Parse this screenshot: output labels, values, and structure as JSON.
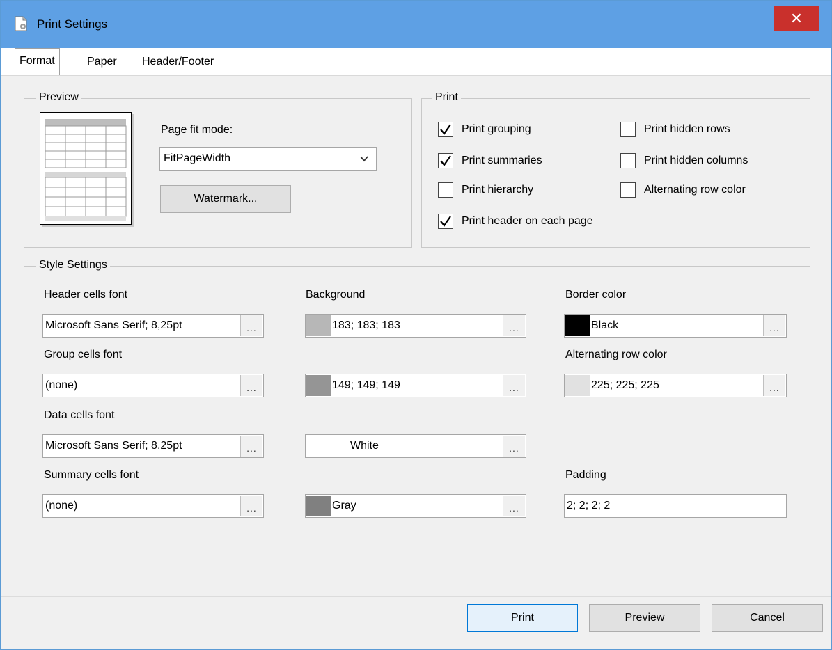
{
  "window": {
    "title": "Print Settings",
    "close_symbol": "✕"
  },
  "tabs": [
    {
      "label": "Format",
      "active": true
    },
    {
      "label": "Paper",
      "active": false
    },
    {
      "label": "Header/Footer",
      "active": false
    }
  ],
  "preview": {
    "group_title": "Preview",
    "page_fit_label": "Page fit mode:",
    "page_fit_value": "FitPageWidth",
    "watermark_button": "Watermark..."
  },
  "print": {
    "group_title": "Print",
    "options": [
      {
        "label": "Print grouping",
        "checked": true
      },
      {
        "label": "Print summaries",
        "checked": true
      },
      {
        "label": "Print hierarchy",
        "checked": false
      },
      {
        "label": "Print header on each page",
        "checked": true
      },
      {
        "label": "Print hidden rows",
        "checked": false
      },
      {
        "label": "Print hidden columns",
        "checked": false
      },
      {
        "label": "Alternating row color",
        "checked": false
      }
    ]
  },
  "style": {
    "group_title": "Style Settings",
    "fonts": [
      {
        "label": "Header cells font",
        "value": "Microsoft Sans Serif; 8,25pt"
      },
      {
        "label": "Group cells font",
        "value": "(none)"
      },
      {
        "label": "Data cells font",
        "value": "Microsoft Sans Serif; 8,25pt"
      },
      {
        "label": "Summary cells font",
        "value": "(none)"
      }
    ],
    "background_label": "Background",
    "backgrounds": [
      {
        "value": "183; 183; 183",
        "color": "#b7b7b7"
      },
      {
        "value": "149; 149; 149",
        "color": "#959595"
      },
      {
        "value": "White",
        "color": "#ffffff"
      },
      {
        "value": "Gray",
        "color": "#808080"
      }
    ],
    "border_color_label": "Border color",
    "border_color": {
      "value": "Black",
      "color": "#000000"
    },
    "alternating_label": "Alternating row color",
    "alternating": {
      "value": "225; 225; 225",
      "color": "#e1e1e1"
    },
    "padding_label": "Padding",
    "padding_value": "2; 2; 2; 2",
    "ellipsis": "..."
  },
  "footer": {
    "print_button": "Print",
    "preview_button": "Preview",
    "cancel_button": "Cancel"
  },
  "colors": {
    "titlebar": "#5ea0e4",
    "close": "#c9302c",
    "default_button_border": "#0078d7"
  }
}
